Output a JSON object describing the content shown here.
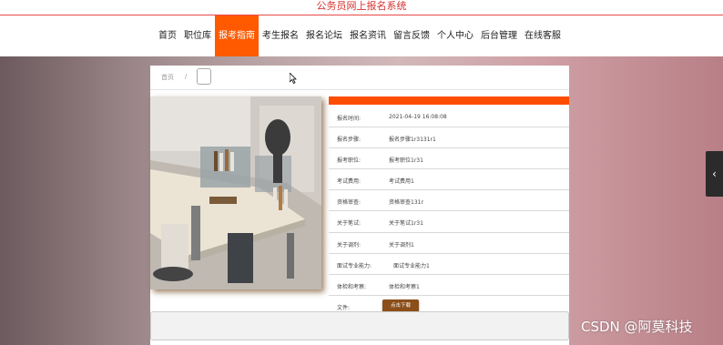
{
  "header": {
    "site_title": "公务员网上报名系统"
  },
  "nav": {
    "items": [
      "首页",
      "职位库",
      "报考指南",
      "考生报名",
      "报名论坛",
      "报名资讯",
      "留言反馈",
      "个人中心",
      "后台管理",
      "在线客服"
    ],
    "active_index": 2
  },
  "breadcrumb": {
    "home": "首页",
    "separator": "/"
  },
  "details": [
    {
      "key": "报名时间:",
      "value": "2021-04-19 16:08:08"
    },
    {
      "key": "报名步骤:",
      "value": "报名步骤1r3131r1"
    },
    {
      "key": "报考职位:",
      "value": "报考职位1r31"
    },
    {
      "key": "考试费用:",
      "value": "考试费用1"
    },
    {
      "key": "资格审查:",
      "value": "资格审查131r"
    },
    {
      "key": "关于笔试:",
      "value": "关于笔试1r31"
    },
    {
      "key": "关于调剂:",
      "value": "关于调剂1"
    },
    {
      "key": "面试专业能力:",
      "value": "面试专业能力1"
    },
    {
      "key": "体检和考察:",
      "value": "体检和考察1"
    },
    {
      "key": "文件:",
      "value": ""
    }
  ],
  "download_label": "点击下载",
  "right_toggle": "‹",
  "watermark": "CSDN @阿莫科技",
  "colors": {
    "accent": "#ff5a00",
    "title_red": "#d8322f",
    "download_btn": "#8b4f1a"
  }
}
